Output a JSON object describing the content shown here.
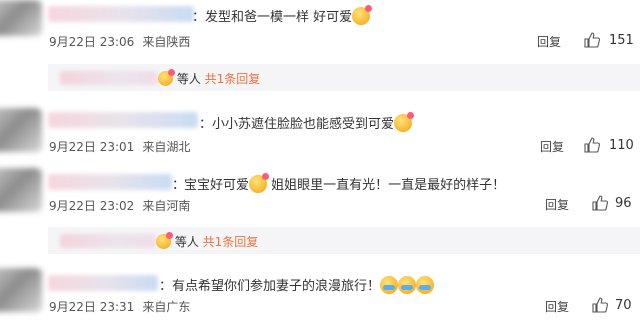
{
  "comments": [
    {
      "text": "发型和爸一模一样 好可爱",
      "date": "9月22日 23:06",
      "location": "来自陕西",
      "reply_label": "回复",
      "likes": "151",
      "emoji": "heart-smile-emoji"
    },
    {
      "text": "小小苏遮住脸脸也能感受到可爱",
      "date": "9月22日 23:01",
      "location": "来自湖北",
      "reply_label": "回复",
      "likes": "110",
      "emoji": "heart-smile-emoji"
    },
    {
      "text": "宝宝好可爱",
      "text2": "姐姐眼里一直有光！一直是最好的样子！",
      "date": "9月22日 23:02",
      "location": "来自河南",
      "reply_label": "回复",
      "likes": "96",
      "emoji": "heart-smile-emoji"
    },
    {
      "text": "有点希望你们参加妻子的浪漫旅行！",
      "date": "9月22日 23:31",
      "location": "来自广东",
      "reply_label": "回复",
      "likes": "70",
      "emoji": "crying-laugh-emoji"
    }
  ],
  "subreplies": [
    {
      "etc": "等人",
      "link": "共1条回复"
    },
    {
      "etc": "等人",
      "link": "共1条回复"
    }
  ],
  "colon": "："
}
